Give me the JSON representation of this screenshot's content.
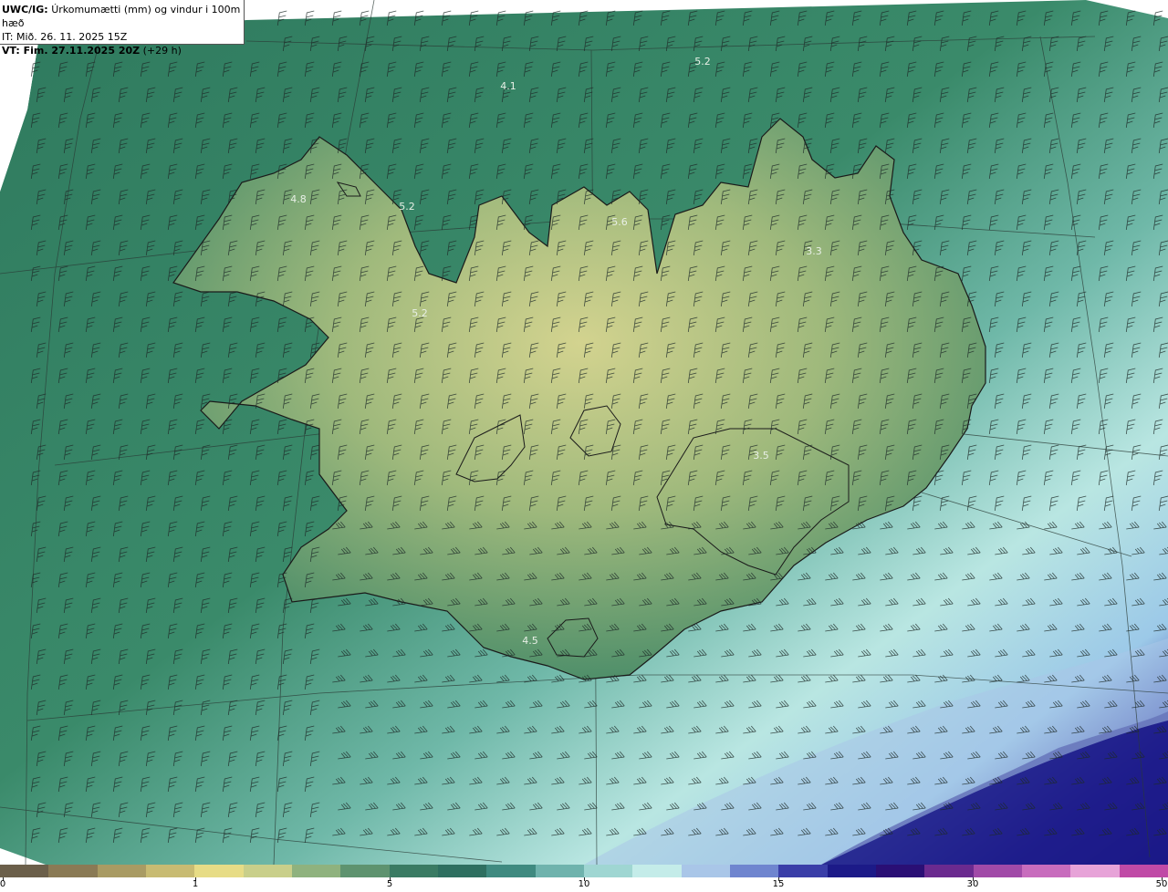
{
  "header": {
    "model_prefix": "UWC/IG:",
    "field_desc": "Úrkomumætti (mm) og vindur i 100m hæð",
    "issue_time": "IT: Mið. 26. 11. 2025 15Z",
    "valid_prefix": "VT: Fim. 27.11.2025 20Z",
    "valid_suffix": " (+29 h)"
  },
  "map": {
    "value_labels": [
      "5.2",
      "4.1",
      "4.8",
      "5.2",
      "5.6",
      "3.3",
      "5.2",
      "3.5",
      "4.5"
    ],
    "colors": {
      "ocean_dark": "#2f6f5c",
      "land_low": "#4f8f6a",
      "land_high": "#c9cf8a",
      "precip_light": "#9fe0dc",
      "precip_heavy": "#1a1580"
    }
  },
  "colorbar": {
    "ticks": [
      "0",
      "1",
      "5",
      "10",
      "15",
      "30",
      "50"
    ],
    "segments": [
      {
        "color": "#6b5f4a"
      },
      {
        "color": "#8a7a55"
      },
      {
        "color": "#a99b63"
      },
      {
        "color": "#c8bb72"
      },
      {
        "color": "#e7dc86"
      },
      {
        "color": "#c9cf8a"
      },
      {
        "color": "#8fb27e"
      },
      {
        "color": "#5e936f"
      },
      {
        "color": "#3a7b63"
      },
      {
        "color": "#2e6f60"
      },
      {
        "color": "#3f8a80"
      },
      {
        "color": "#6fb3ad"
      },
      {
        "color": "#9fd6d2"
      },
      {
        "color": "#c4ece9"
      },
      {
        "color": "#a9c6e8"
      },
      {
        "color": "#6f85cf"
      },
      {
        "color": "#3a3ea8"
      },
      {
        "color": "#1c1a88"
      },
      {
        "color": "#2a0f75"
      },
      {
        "color": "#6a2a8f"
      },
      {
        "color": "#a14aa8"
      },
      {
        "color": "#c86cbd"
      },
      {
        "color": "#e7a3d8"
      },
      {
        "color": "#c04aa6"
      }
    ]
  }
}
